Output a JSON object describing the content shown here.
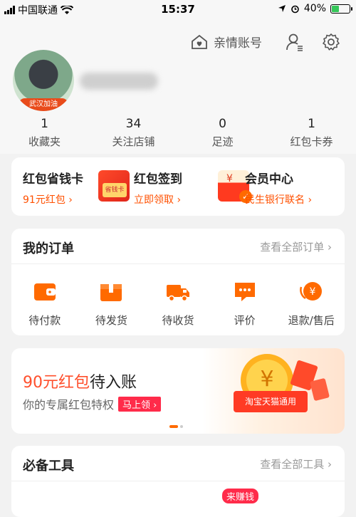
{
  "status": {
    "carrier": "中国联通",
    "time": "15:37",
    "battery": "40%"
  },
  "header": {
    "family_account": "亲情账号",
    "avatar_badge": "武汉加油"
  },
  "stats": [
    {
      "num": "1",
      "label": "收藏夹"
    },
    {
      "num": "34",
      "label": "关注店铺"
    },
    {
      "num": "0",
      "label": "足迹"
    },
    {
      "num": "1",
      "label": "红包卡券"
    }
  ],
  "promos": [
    {
      "title": "红包省钱卡",
      "sub": "91元红包 ›",
      "pic_text": "省钱卡"
    },
    {
      "title": "红包签到",
      "sub": "立即领取 ›",
      "pic_text": "¥"
    },
    {
      "title": "会员中心",
      "sub": "民生银行联名 ›"
    }
  ],
  "orders": {
    "title": "我的订单",
    "more": "查看全部订单 ›",
    "items": [
      "待付款",
      "待发货",
      "待收货",
      "评价",
      "退款/售后"
    ]
  },
  "banner": {
    "amount": "90元红包",
    "headline_rest": "待入账",
    "sub": "你的专属红包特权",
    "cta": "马上领 ›",
    "art_label": "淘宝天猫通用"
  },
  "tools": {
    "title": "必备工具",
    "more": "查看全部工具 ›",
    "earn_badge": "来赚钱"
  },
  "colors": {
    "accent": "#ff5000",
    "red": "#ff2b4a",
    "bg": "#f2f2f2"
  }
}
